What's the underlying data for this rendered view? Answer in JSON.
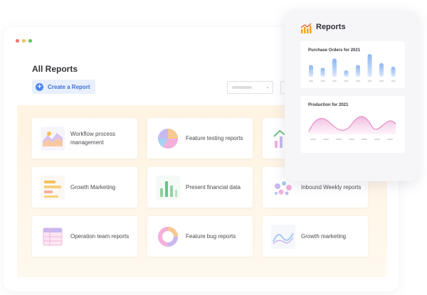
{
  "page": {
    "title": "All Reports"
  },
  "toolbar": {
    "create_label": "Create a Report",
    "plus_glyph": "+"
  },
  "reports": [
    {
      "label": "Workflow process management",
      "icon": "area-chart-icon"
    },
    {
      "label": "Feature testing reports",
      "icon": "pie-chart-icon"
    },
    {
      "label": "",
      "icon": "bar-line-chart-icon"
    },
    {
      "label": "Growth Marketing",
      "icon": "horizontal-bar-icon"
    },
    {
      "label": "Present financial data",
      "icon": "bar-chart-icon"
    },
    {
      "label": "Inbound Weekly reports",
      "icon": "bubble-chart-icon"
    },
    {
      "label": "Operation team reports",
      "icon": "table-icon"
    },
    {
      "label": "Feature bug reports",
      "icon": "donut-chart-icon"
    },
    {
      "label": "Growth marketing",
      "icon": "line-chart-icon"
    }
  ],
  "panel": {
    "title": "Reports",
    "purchase": {
      "title": "Purchase Orders for 2021",
      "values": [
        0.52,
        0.4,
        0.8,
        0.28,
        0.52,
        1.0,
        0.6,
        0.44
      ]
    },
    "production": {
      "title": "Production for 2021"
    }
  },
  "colors": {
    "accent": "#4e86f4",
    "bar": "#a9c6f5",
    "wave": "#e9a7d6",
    "grid_bg": "#fff3e2"
  }
}
